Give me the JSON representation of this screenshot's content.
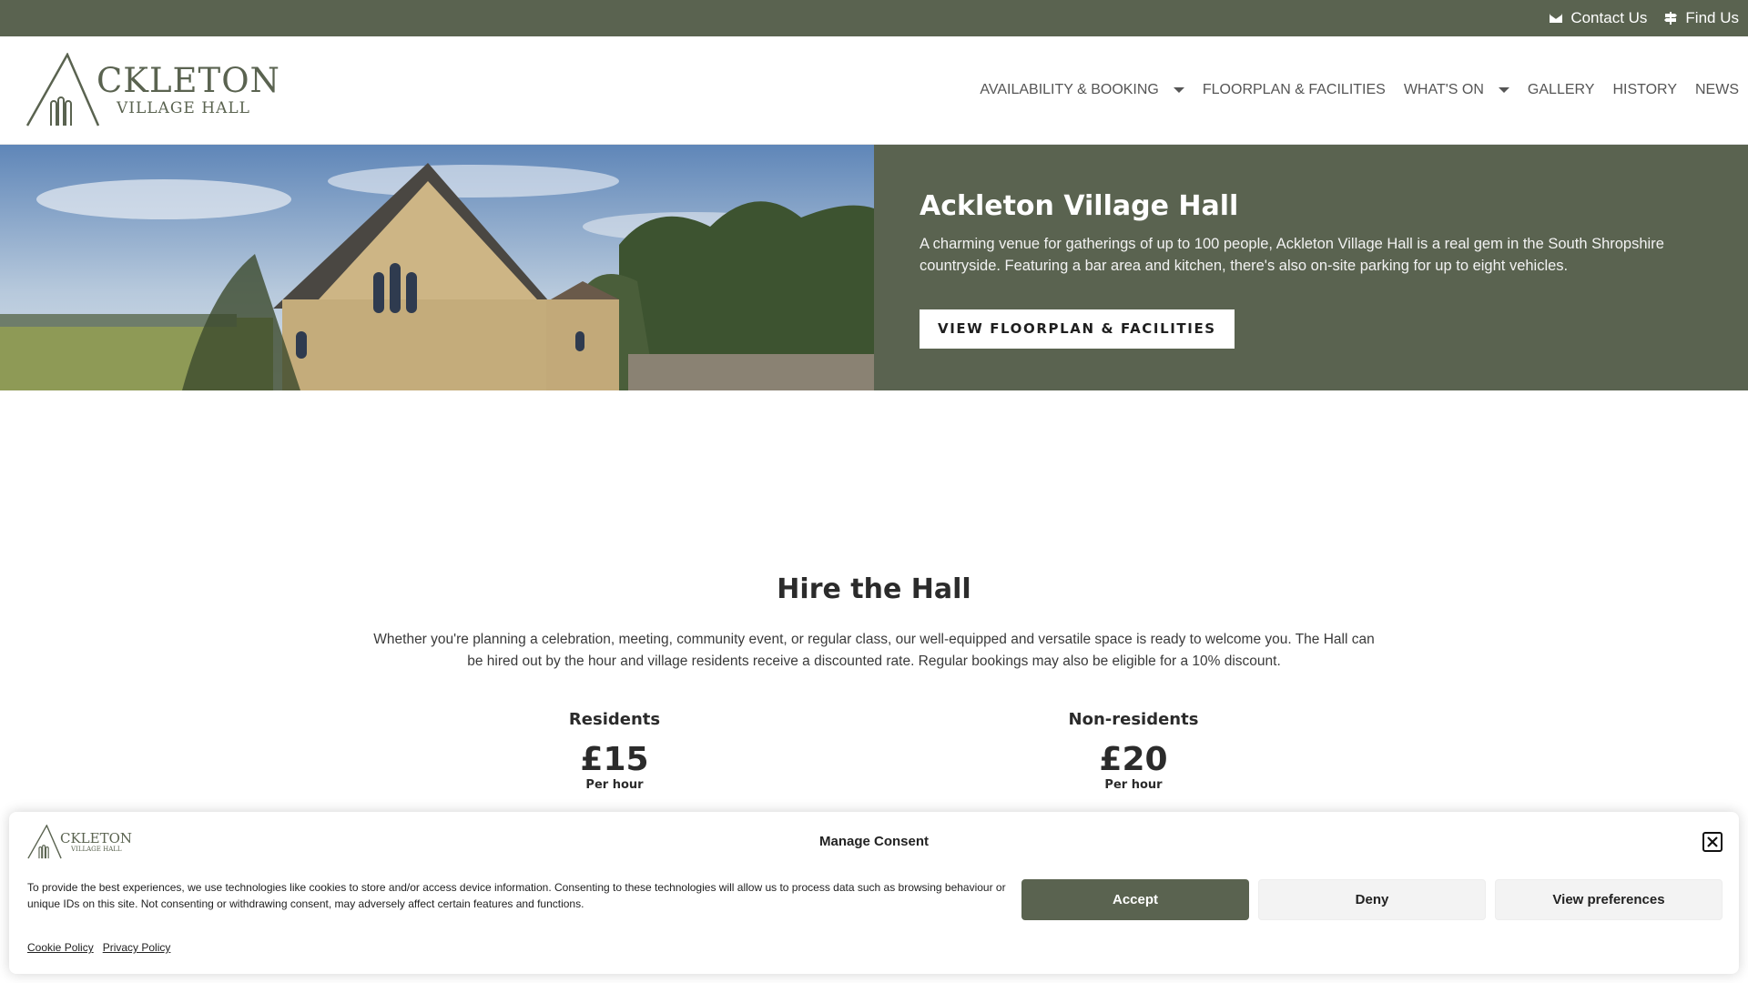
{
  "topbar": {
    "contact_label": "Contact Us",
    "find_label": "Find Us"
  },
  "logo": {
    "name_big": "CKLETON",
    "name_small": "VILLAGE HALL"
  },
  "nav": {
    "items": [
      {
        "label": "AVAILABILITY & BOOKING",
        "has_dropdown": true
      },
      {
        "label": "FLOORPLAN & FACILITIES",
        "has_dropdown": false
      },
      {
        "label": "WHAT'S ON",
        "has_dropdown": true
      },
      {
        "label": "GALLERY",
        "has_dropdown": false
      },
      {
        "label": "HISTORY",
        "has_dropdown": false
      },
      {
        "label": "NEWS",
        "has_dropdown": false
      }
    ]
  },
  "hero": {
    "title": "Ackleton Village Hall",
    "text": "A charming venue for gatherings of up to 100 people, Ackleton Village Hall is a real gem in the South Shropshire countryside. Featuring a bar area and kitchen, there's also on-site parking for up to eight vehicles.",
    "button_label": "VIEW FLOORPLAN & FACILITIES"
  },
  "hire": {
    "title": "Hire the Hall",
    "text": "Whether you're planning a celebration, meeting, community event, or regular class, our well-equipped and versatile space is ready to welcome you. The Hall can be hired out by the hour and village residents receive a discounted rate. Regular bookings may also be eligible for a 10% discount.",
    "rates": [
      {
        "label": "Residents",
        "price": "£15",
        "unit": "Per hour"
      },
      {
        "label": "Non-residents",
        "price": "£20",
        "unit": "Per hour"
      }
    ]
  },
  "consent": {
    "title": "Manage Consent",
    "text": "To provide the best experiences, we use technologies like cookies to store and/or access device information. Consenting to these technologies will allow us to process data such as browsing behaviour or unique IDs on this site. Not consenting or withdrawing consent, may adversely affect certain features and functions.",
    "accept_label": "Accept",
    "deny_label": "Deny",
    "prefs_label": "View preferences",
    "links": [
      "Cookie Policy",
      "Privacy Policy"
    ]
  },
  "colors": {
    "brand": "#5a6350",
    "text": "#2b2b2b"
  },
  "icons": {
    "contact": "envelope-icon",
    "find": "signpost-icon",
    "close": "close-icon"
  }
}
